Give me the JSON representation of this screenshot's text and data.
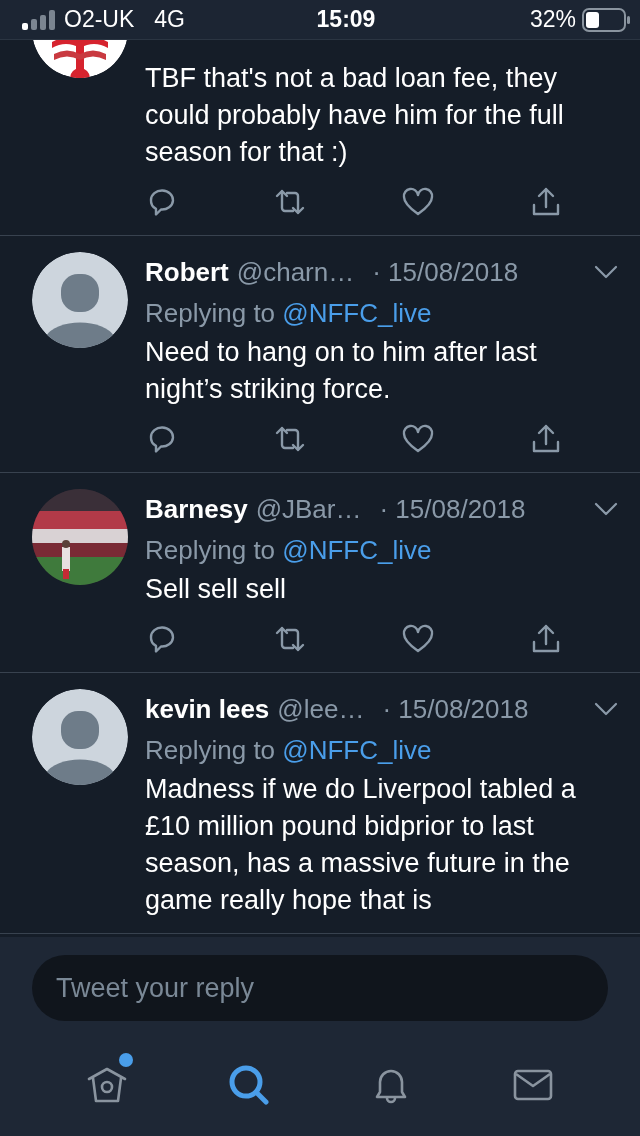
{
  "status_bar": {
    "carrier": "O2-UK",
    "network": "4G",
    "time": "15:09",
    "battery": "32%"
  },
  "tweets": [
    {
      "avatar": {
        "kind": "crest"
      },
      "text": "TBF that's not a bad loan fee, they could probably have him for the full season for that :)",
      "actions_shown": true
    },
    {
      "avatar": {
        "kind": "default"
      },
      "name": "Robert",
      "handle": "@charn…",
      "date": "· 15/08/2018",
      "replying_label": "Replying to",
      "replying_to": "@NFFC_live",
      "text": "Need to hang on to him after last night’s striking force.",
      "actions_shown": true
    },
    {
      "name": "Barnesy",
      "handle": "@JBar…",
      "date": "· 15/08/2018",
      "replying_label": "Replying to",
      "replying_to": "@NFFC_live",
      "text": "Sell sell sell",
      "actions_shown": true
    },
    {
      "avatar": {
        "kind": "default"
      },
      "name": "kevin lees",
      "handle": "@lee…",
      "date": "· 15/08/2018",
      "replying_label": "Replying to",
      "replying_to": "@NFFC_live",
      "text": "Madness if we do Liverpool tabled a £10 million pound bidprior to last season, has a massive future in the game really hope that is",
      "actions_shown": false
    }
  ],
  "reply": {
    "placeholder": "Tweet your reply"
  },
  "nav": [
    {
      "kind": "home",
      "selected": false,
      "badge": true
    },
    {
      "kind": "search",
      "selected": true,
      "badge": false
    },
    {
      "kind": "notifications",
      "selected": false,
      "badge": false
    },
    {
      "kind": "messages",
      "selected": false,
      "badge": false
    }
  ]
}
